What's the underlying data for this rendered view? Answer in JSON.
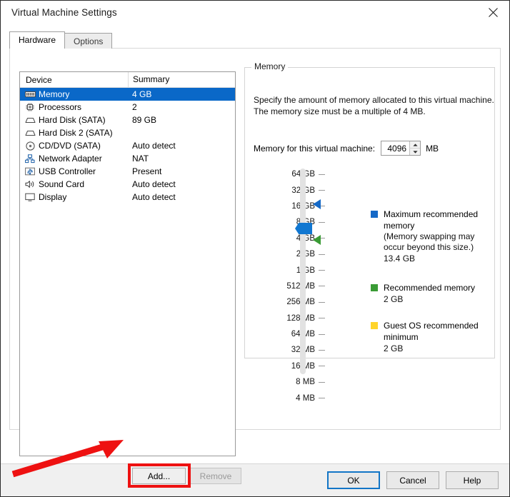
{
  "window": {
    "title": "Virtual Machine Settings",
    "close_icon": "close-icon"
  },
  "tabs": [
    {
      "label": "Hardware",
      "active": true
    },
    {
      "label": "Options",
      "active": false
    }
  ],
  "device_list": {
    "columns": [
      "Device",
      "Summary"
    ],
    "rows": [
      {
        "icon": "memory-icon",
        "device": "Memory",
        "summary": "4 GB",
        "selected": true
      },
      {
        "icon": "processor-icon",
        "device": "Processors",
        "summary": "2",
        "selected": false
      },
      {
        "icon": "harddisk-icon",
        "device": "Hard Disk (SATA)",
        "summary": "89 GB",
        "selected": false
      },
      {
        "icon": "harddisk-icon",
        "device": "Hard Disk 2 (SATA)",
        "summary": "",
        "selected": false
      },
      {
        "icon": "cddvd-icon",
        "device": "CD/DVD (SATA)",
        "summary": "Auto detect",
        "selected": false
      },
      {
        "icon": "network-icon",
        "device": "Network Adapter",
        "summary": "NAT",
        "selected": false
      },
      {
        "icon": "usb-icon",
        "device": "USB Controller",
        "summary": "Present",
        "selected": false
      },
      {
        "icon": "sound-icon",
        "device": "Sound Card",
        "summary": "Auto detect",
        "selected": false
      },
      {
        "icon": "display-icon",
        "device": "Display",
        "summary": "Auto detect",
        "selected": false
      }
    ]
  },
  "list_buttons": {
    "add_label": "Add...",
    "remove_label": "Remove",
    "remove_disabled": true,
    "add_highlight_color": "#ee1111"
  },
  "memory_panel": {
    "group_label": "Memory",
    "description": "Specify the amount of memory allocated to this virtual machine. The memory size must be a multiple of 4 MB.",
    "field_label": "Memory for this virtual machine:",
    "value": "4096",
    "unit": "MB",
    "slider": {
      "ticks": [
        "64 GB",
        "32 GB",
        "16 GB",
        "8 GB",
        "4 GB",
        "2 GB",
        "1 GB",
        "512 MB",
        "256 MB",
        "128 MB",
        "64 MB",
        "32 MB",
        "16 MB",
        "8 MB",
        "4 MB"
      ],
      "current_tick": "4 GB",
      "max_recommended_tick": "16 GB",
      "recommended_tick": "2 GB",
      "thumb_color": "#1177d1",
      "max_marker_color": "#1569c7",
      "recommended_marker_color": "#3a9b35"
    },
    "legend": [
      {
        "swatch": "blue",
        "title": "Maximum recommended memory",
        "sub1": "(Memory swapping may",
        "sub2": "occur beyond this size.)",
        "value": "13.4 GB"
      },
      {
        "swatch": "green",
        "title": "Recommended memory",
        "sub1": "",
        "sub2": "",
        "value": "2 GB"
      },
      {
        "swatch": "yellow",
        "title": "Guest OS recommended minimum",
        "sub1": "",
        "sub2": "",
        "value": "2 GB"
      }
    ]
  },
  "footer": {
    "ok_label": "OK",
    "cancel_label": "Cancel",
    "help_label": "Help"
  }
}
